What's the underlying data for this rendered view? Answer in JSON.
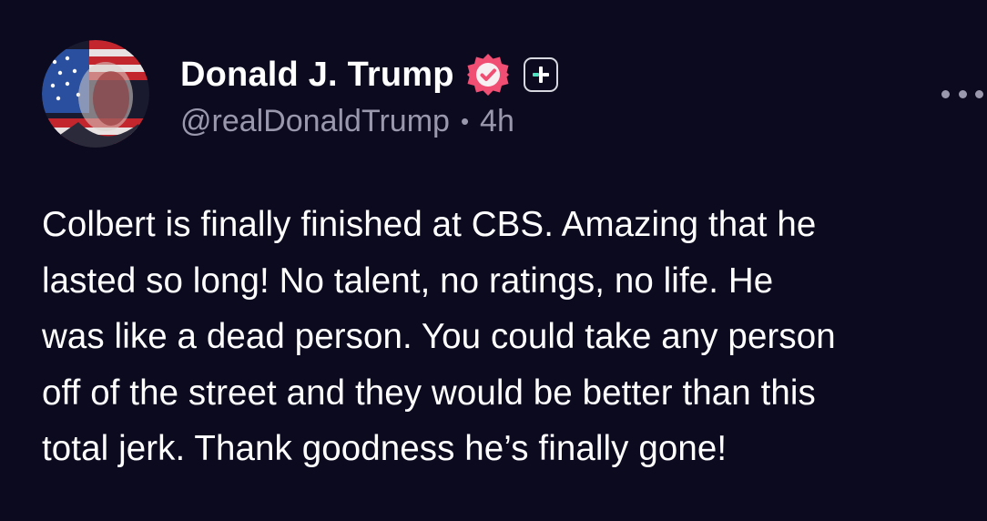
{
  "author": {
    "display_name": "Donald J. Trump",
    "handle": "@realDonaldTrump",
    "separator": "•",
    "time_ago": "4h"
  },
  "icons": {
    "verified": "verified-badge-icon",
    "plus": "plus-icon",
    "more": "more-horizontal-icon"
  },
  "colors": {
    "background": "#0c0a1f",
    "verified_badge": "#f04e72",
    "plus_accent": "#4fe0c0",
    "secondary_text": "#9a98ad"
  },
  "post": {
    "text": "Colbert is finally finished at CBS. Amazing that he\nlasted so long! No talent, no ratings, no life. He\nwas like a dead person. You could take any person\noff of the street and they would be better than this\ntotal jerk. Thank goodness he’s finally gone!"
  }
}
